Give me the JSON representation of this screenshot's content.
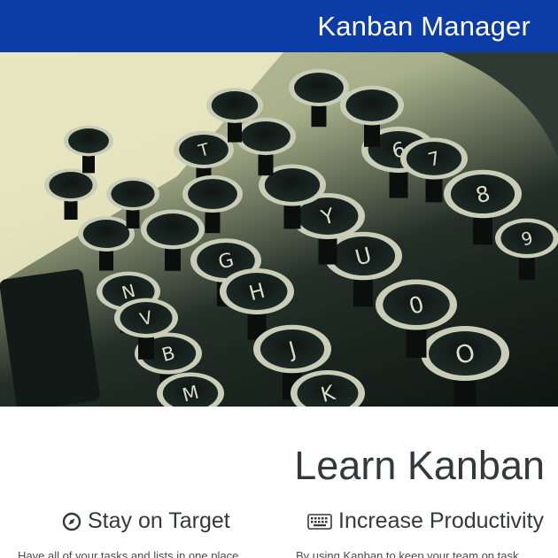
{
  "navbar": {
    "brand": "Kanban Manager"
  },
  "hero": {
    "image": "typewriter-keys-photo",
    "keys": [
      "B",
      "G",
      "H",
      "J",
      "K",
      "M",
      "N",
      "O",
      "T",
      "U",
      "V",
      "Y",
      "8",
      "9",
      "6",
      "7",
      "0"
    ]
  },
  "main": {
    "title": "Learn Kanban",
    "features": [
      {
        "icon": "compass-icon",
        "heading": "Stay on Target",
        "text": "Have all of your tasks and lists in one place"
      },
      {
        "icon": "keyboard-icon",
        "heading": "Increase Productivity",
        "text": "By using Kanban to keep your team on task"
      }
    ]
  },
  "colors": {
    "navbar": "#0b3ca8",
    "text": "#36393c"
  }
}
